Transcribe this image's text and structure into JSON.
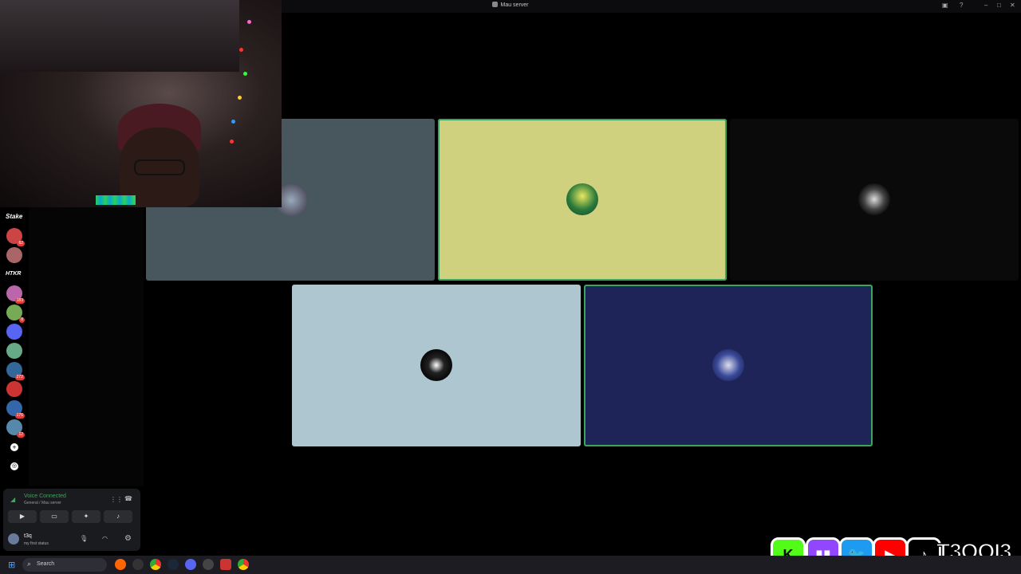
{
  "window": {
    "title": "Mau server"
  },
  "voice": {
    "status": "Voice Connected",
    "channel": "General / Mau server",
    "buttons": [
      "Camera",
      "Screen",
      "Activities",
      "Soundboard"
    ]
  },
  "user": {
    "name": "t3q",
    "status": "my first status"
  },
  "servers": [
    {
      "name": "Stake",
      "text": "Stake"
    },
    {
      "badge": "62"
    },
    {
      "badge": ""
    },
    {
      "name": "HTKR",
      "text": "HTKR"
    },
    {
      "badge": "183"
    },
    {
      "badge": "8"
    },
    {
      "badge": ""
    },
    {
      "badge": ""
    },
    {
      "badge": "272"
    },
    {
      "badge": ""
    },
    {
      "badge": "176"
    },
    {
      "badge": "12"
    }
  ],
  "taskbar": {
    "search_placeholder": "Search"
  },
  "overlay": {
    "handle": "T3OQI3",
    "kick_letter": "K"
  },
  "colors": {
    "tile1": "#48575e",
    "tile2": "#cfd17f",
    "tile3": "#0a0a0a",
    "tile4": "#aec6d0",
    "tile5": "#1e2458",
    "speaking": "#3ba55c",
    "accent_green": "#3ba55c"
  }
}
